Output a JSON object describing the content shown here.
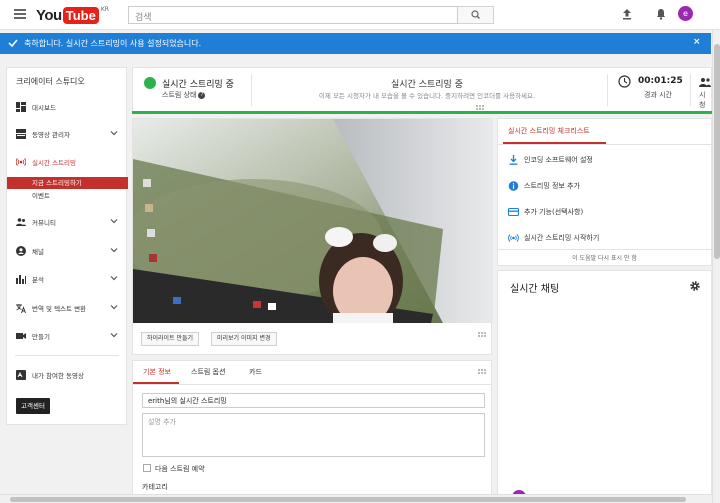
{
  "header": {
    "logo_you": "You",
    "logo_tube": "Tube",
    "logo_region": "KR",
    "search_placeholder": "검색",
    "avatar_letter": "e"
  },
  "notice": {
    "text": "축하합니다. 실시간 스트리밍이 사용 설정되었습니다.",
    "close": "×"
  },
  "sidebar": {
    "title": "크리에이터 스튜디오",
    "items": [
      {
        "label": "대시보드",
        "icon": "dashboard-icon"
      },
      {
        "label": "동영상 관리자",
        "icon": "video-manager-icon"
      },
      {
        "label": "실시간 스트리밍",
        "icon": "live-icon"
      },
      {
        "label": "커뮤니티",
        "icon": "community-icon"
      },
      {
        "label": "채널",
        "icon": "channel-icon"
      },
      {
        "label": "분석",
        "icon": "analytics-icon"
      },
      {
        "label": "번역 및 텍스트 변환",
        "icon": "translate-icon"
      },
      {
        "label": "만들기",
        "icon": "create-icon"
      },
      {
        "label": "내가 참여한 동영상",
        "icon": "contributions-icon"
      }
    ],
    "live_sub": [
      "지금 스트리밍하기",
      "이벤트"
    ],
    "help_button": "고객센터"
  },
  "status": {
    "live_label": "실시간 스트리밍 중",
    "stream_status_label": "스트림 상태",
    "center_title": "실시간 스트리밍 중",
    "center_sub": "이제 모든 시청자가 내 모습을 볼 수 있습니다. 중지하려면 인코더를 사용하세요.",
    "elapsed_time": "00:01:25",
    "elapsed_label": "경과 시간",
    "viewers_label": "시청"
  },
  "video": {
    "highlight_button": "하이라이트 만들기",
    "thumbnail_button": "미리보기 이미지 변경"
  },
  "info": {
    "tabs": [
      "기본 정보",
      "스트림 옵션",
      "카드"
    ],
    "title_value": "erith님의 실시간 스트리밍",
    "description_placeholder": "설명 추가",
    "schedule_label": "다음 스트림 예약",
    "category_label": "카테고리"
  },
  "checklist": {
    "title": "실시간 스트리밍 체크리스트",
    "items": [
      {
        "label": "인코딩 소프트웨어 설정",
        "icon": "download-icon"
      },
      {
        "label": "스트리밍 정보 추가",
        "icon": "info-icon"
      },
      {
        "label": "추가 기능(선택사항)",
        "icon": "card-icon"
      },
      {
        "label": "실시간 스트리밍 시작하기",
        "icon": "live-icon"
      }
    ],
    "footer": "이 도움말 다시 표시 안 함"
  },
  "chat": {
    "title": "실시간 채팅"
  },
  "colors": {
    "accent_red": "#c4302b",
    "live_green": "#2bb24c",
    "notice_blue": "#1f7ed6"
  }
}
